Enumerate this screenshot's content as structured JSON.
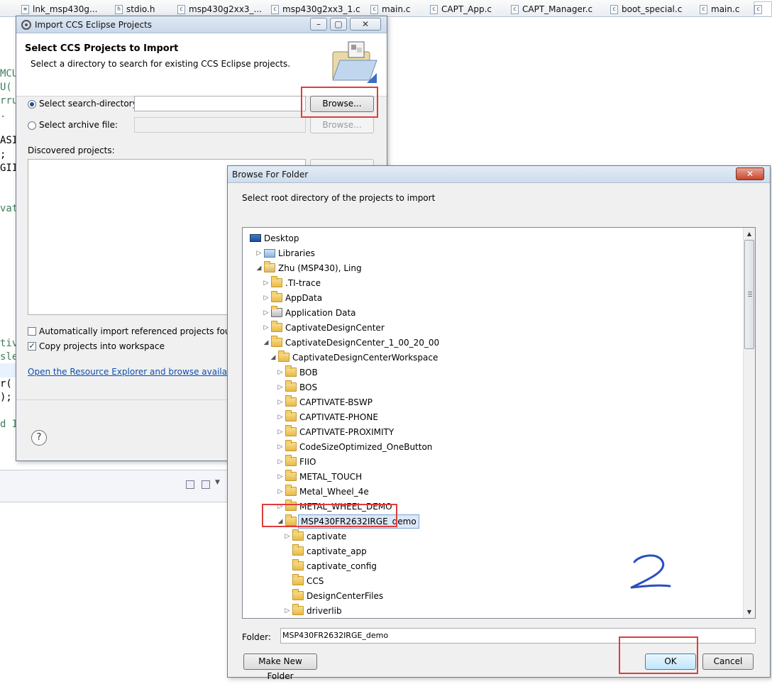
{
  "editor": {
    "tabs": [
      {
        "label": "lnk_msp430g...",
        "icon": "linker-file-icon"
      },
      {
        "label": "stdio.h",
        "icon": "header-file-icon"
      },
      {
        "label": "msp430g2xx3_...",
        "icon": "c-file-icon"
      },
      {
        "label": "msp430g2xx3_1.c",
        "icon": "c-file-icon"
      },
      {
        "label": "main.c",
        "icon": "c-file-icon"
      },
      {
        "label": "CAPT_App.c",
        "icon": "c-file-icon"
      },
      {
        "label": "CAPT_Manager.c",
        "icon": "c-file-icon"
      },
      {
        "label": "boot_special.c",
        "icon": "c-file-icon"
      },
      {
        "label": "main.c",
        "icon": "c-file-icon"
      }
    ],
    "code_fragments": [
      "MCU",
      "U(",
      "rru",
      ".",
      "ASI",
      ";",
      "GII",
      "vat",
      "tiv",
      "sle",
      "r(",
      ");",
      "d I"
    ]
  },
  "import_dialog": {
    "title": "Import CCS Eclipse Projects",
    "heading": "Select CCS Projects to Import",
    "description": "Select a directory to search for existing CCS Eclipse projects.",
    "search_dir_label": "Select search-directory:",
    "search_dir_value": "",
    "browse_label": "Browse...",
    "archive_label": "Select archive file:",
    "archive_browse_label": "Browse...",
    "discovered_label": "Discovered projects:",
    "auto_import_label": "Automatically import referenced projects found in",
    "copy_label": "Copy projects into workspace",
    "resource_link": "Open the Resource Explorer and browse available exa",
    "help_symbol": "?"
  },
  "browse_dialog": {
    "title": "Browse For Folder",
    "prompt": "Select root directory of the projects to import",
    "tree": [
      {
        "label": "Desktop",
        "level": 0,
        "expander": "",
        "icon": "desktop-icon"
      },
      {
        "label": "Libraries",
        "level": 1,
        "expander": "▷",
        "icon": "libraries-icon"
      },
      {
        "label": "Zhu (MSP430), Ling",
        "level": 1,
        "expander": "◢",
        "icon": "user-folder-icon"
      },
      {
        "label": ".TI-trace",
        "level": 2,
        "expander": "▷",
        "icon": "folder-icon"
      },
      {
        "label": "AppData",
        "level": 2,
        "expander": "▷",
        "icon": "folder-icon"
      },
      {
        "label": "Application Data",
        "level": 2,
        "expander": "▷",
        "icon": "shortcut-folder-icon"
      },
      {
        "label": "CaptivateDesignCenter",
        "level": 2,
        "expander": "▷",
        "icon": "folder-icon"
      },
      {
        "label": "CaptivateDesignCenter_1_00_20_00",
        "level": 2,
        "expander": "◢",
        "icon": "folder-icon"
      },
      {
        "label": "CaptivateDesignCenterWorkspace",
        "level": 3,
        "expander": "◢",
        "icon": "folder-icon"
      },
      {
        "label": "BOB",
        "level": 4,
        "expander": "▷",
        "icon": "folder-icon"
      },
      {
        "label": "BOS",
        "level": 4,
        "expander": "▷",
        "icon": "folder-icon"
      },
      {
        "label": "CAPTIVATE-BSWP",
        "level": 4,
        "expander": "▷",
        "icon": "folder-icon"
      },
      {
        "label": "CAPTIVATE-PHONE",
        "level": 4,
        "expander": "▷",
        "icon": "folder-icon"
      },
      {
        "label": "CAPTIVATE-PROXIMITY",
        "level": 4,
        "expander": "▷",
        "icon": "folder-icon"
      },
      {
        "label": "CodeSizeOptimized_OneButton",
        "level": 4,
        "expander": "▷",
        "icon": "folder-icon"
      },
      {
        "label": "FIIO",
        "level": 4,
        "expander": "▷",
        "icon": "folder-icon"
      },
      {
        "label": "METAL_TOUCH",
        "level": 4,
        "expander": "▷",
        "icon": "folder-icon"
      },
      {
        "label": "Metal_Wheel_4e",
        "level": 4,
        "expander": "▷",
        "icon": "folder-icon"
      },
      {
        "label": "METAL_WHEEL_DEMO",
        "level": 4,
        "expander": "▷",
        "icon": "folder-icon"
      },
      {
        "label": "MSP430FR2632IRGE_demo",
        "level": 4,
        "expander": "◢",
        "icon": "folder-icon",
        "selected": true
      },
      {
        "label": "captivate",
        "level": 5,
        "expander": "▷",
        "icon": "folder-icon"
      },
      {
        "label": "captivate_app",
        "level": 5,
        "expander": "",
        "icon": "folder-icon"
      },
      {
        "label": "captivate_config",
        "level": 5,
        "expander": "",
        "icon": "folder-icon"
      },
      {
        "label": "CCS",
        "level": 5,
        "expander": "",
        "icon": "folder-icon"
      },
      {
        "label": "DesignCenterFiles",
        "level": 5,
        "expander": "",
        "icon": "folder-icon"
      },
      {
        "label": "driverlib",
        "level": 5,
        "expander": "▷",
        "icon": "folder-icon"
      }
    ],
    "folder_label": "Folder:",
    "folder_value": "MSP430FR2632IRGE_demo",
    "make_new_folder_label": "Make New Folder",
    "ok_label": "OK",
    "cancel_label": "Cancel"
  },
  "annotation": {
    "text": "2",
    "highlight_color": "#e03c3c",
    "ink_color": "#2a4fc0"
  }
}
